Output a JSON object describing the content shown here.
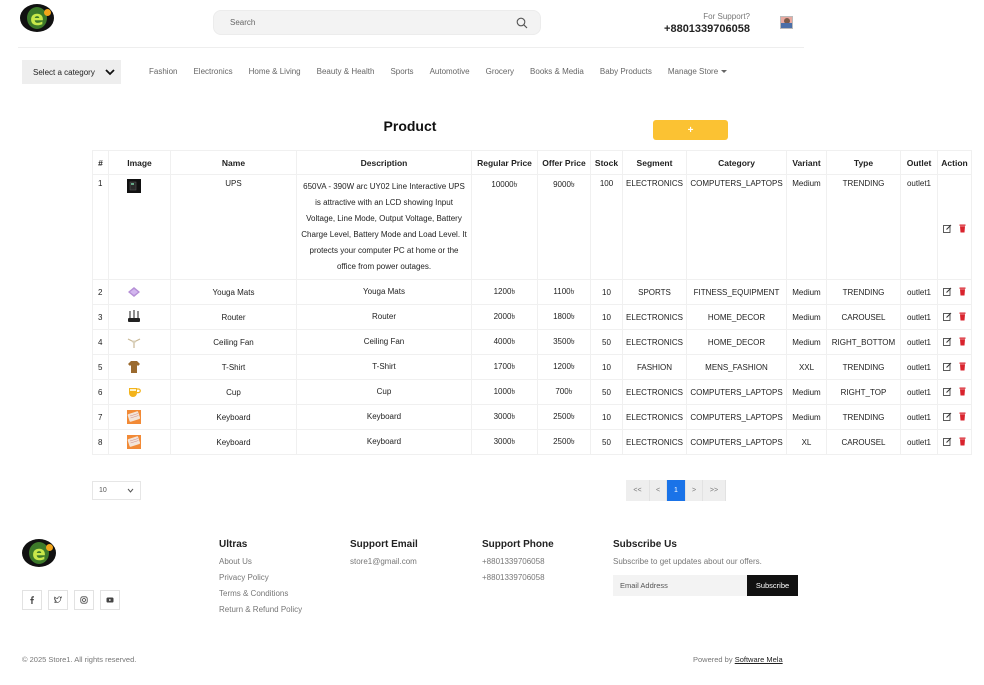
{
  "header": {
    "search_placeholder": "Search",
    "support_label": "For Support?",
    "support_phone": "+8801339706058"
  },
  "nav": {
    "category_select": "Select a category",
    "items": [
      "Fashion",
      "Electronics",
      "Home & Living",
      "Beauty & Health",
      "Sports",
      "Automotive",
      "Grocery",
      "Books & Media",
      "Baby Products"
    ],
    "manage_store": "Manage Store"
  },
  "product": {
    "title": "Product",
    "add_label": "+",
    "columns": [
      "#",
      "Image",
      "Name",
      "Description",
      "Regular Price",
      "Offer Price",
      "Stock",
      "Segment",
      "Category",
      "Variant",
      "Type",
      "Outlet",
      "Action"
    ],
    "rows": [
      {
        "num": "1",
        "image": "ups-image",
        "name": "UPS",
        "description": "650VA - 390W arc UY02 Line Interactive UPS is attractive with an LCD showing Input Voltage, Line Mode, Output Voltage, Battery Charge Level, Battery Mode and Load Level. It protects your computer PC at home or the office from power outages.",
        "regular": "10000৳",
        "offer": "9000৳",
        "stock": "100",
        "segment": "ELECTRONICS",
        "category": "COMPUTERS_LAPTOPS",
        "variant": "Medium",
        "type": "TRENDING",
        "outlet": "outlet1"
      },
      {
        "num": "2",
        "image": "yoga-mat-image",
        "name": "Youga Mats",
        "description": "Youga Mats",
        "regular": "1200৳",
        "offer": "1100৳",
        "stock": "10",
        "segment": "SPORTS",
        "category": "FITNESS_EQUIPMENT",
        "variant": "Medium",
        "type": "TRENDING",
        "outlet": "outlet1"
      },
      {
        "num": "3",
        "image": "router-image",
        "name": "Router",
        "description": "Router",
        "regular": "2000৳",
        "offer": "1800৳",
        "stock": "10",
        "segment": "ELECTRONICS",
        "category": "HOME_DECOR",
        "variant": "Medium",
        "type": "CAROUSEL",
        "outlet": "outlet1"
      },
      {
        "num": "4",
        "image": "ceiling-fan-image",
        "name": "Ceiling Fan",
        "description": "Ceiling Fan",
        "regular": "4000৳",
        "offer": "3500৳",
        "stock": "50",
        "segment": "ELECTRONICS",
        "category": "HOME_DECOR",
        "variant": "Medium",
        "type": "RIGHT_BOTTOM",
        "outlet": "outlet1"
      },
      {
        "num": "5",
        "image": "t-shirt-image",
        "name": "T-Shirt",
        "description": "T-Shirt",
        "regular": "1700৳",
        "offer": "1200৳",
        "stock": "10",
        "segment": "FASHION",
        "category": "MENS_FASHION",
        "variant": "XXL",
        "type": "TRENDING",
        "outlet": "outlet1"
      },
      {
        "num": "6",
        "image": "cup-image",
        "name": "Cup",
        "description": "Cup",
        "regular": "1000৳",
        "offer": "700৳",
        "stock": "50",
        "segment": "ELECTRONICS",
        "category": "COMPUTERS_LAPTOPS",
        "variant": "Medium",
        "type": "RIGHT_TOP",
        "outlet": "outlet1"
      },
      {
        "num": "7",
        "image": "keyboard-image",
        "name": "Keyboard",
        "description": "Keyboard",
        "regular": "3000৳",
        "offer": "2500৳",
        "stock": "10",
        "segment": "ELECTRONICS",
        "category": "COMPUTERS_LAPTOPS",
        "variant": "Medium",
        "type": "TRENDING",
        "outlet": "outlet1"
      },
      {
        "num": "8",
        "image": "keyboard-image",
        "name": "Keyboard",
        "description": "Keyboard",
        "regular": "3000৳",
        "offer": "2500৳",
        "stock": "50",
        "segment": "ELECTRONICS",
        "category": "COMPUTERS_LAPTOPS",
        "variant": "XL",
        "type": "CAROUSEL",
        "outlet": "outlet1"
      }
    ]
  },
  "pagination": {
    "page_size": "10",
    "first": "<<",
    "prev": "<",
    "current": "1",
    "next": ">",
    "last": ">>"
  },
  "footer": {
    "col1_title": "Ultras",
    "col1_links": [
      "About Us",
      "Privacy Policy",
      "Terms & Conditions",
      "Return & Refund Policy"
    ],
    "email_title": "Support Email",
    "email": "store1@gmail.com",
    "phone_title": "Support Phone",
    "phones": [
      "+8801339706058",
      "+8801339706058"
    ],
    "subscribe_title": "Subscribe Us",
    "subscribe_text": "Subscribe to get updates about our offers.",
    "email_placeholder": "Email Address",
    "subscribe_button": "Subscribe",
    "copyright": "© 2025 Store1. All rights reserved.",
    "powered_by": "Powered by",
    "powered_link": "Software Mela"
  },
  "colors": {
    "accent": "#fbc233",
    "active_page": "#1a73e8",
    "delete": "#d9232d"
  }
}
